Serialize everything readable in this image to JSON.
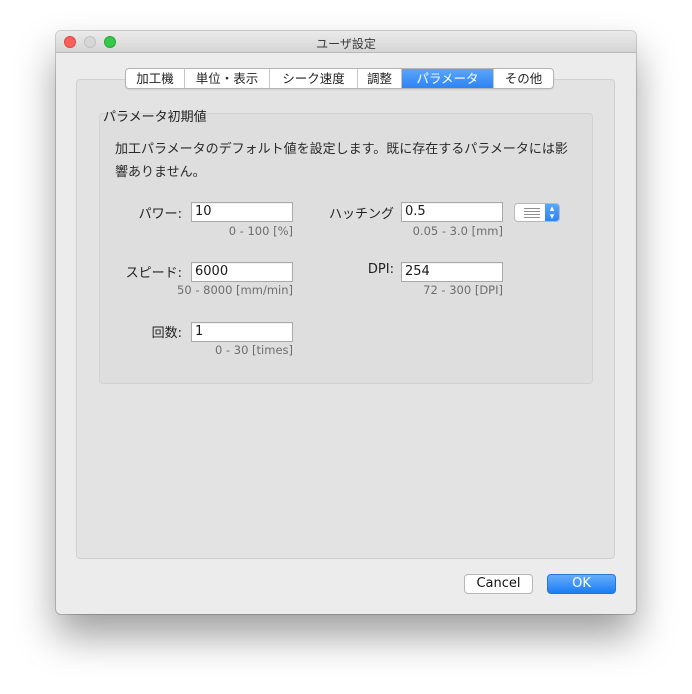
{
  "window": {
    "title": "ユーザ設定"
  },
  "tabs": [
    {
      "label": "加工機",
      "active": false
    },
    {
      "label": "単位・表示",
      "active": false
    },
    {
      "label": "シーク速度",
      "active": false
    },
    {
      "label": "調整",
      "active": false
    },
    {
      "label": "パラメータ",
      "active": true
    },
    {
      "label": "その他",
      "active": false
    }
  ],
  "group": {
    "title": "パラメータ初期値",
    "description": "加工パラメータのデフォルト値を設定します。既に存在するパラメータには影響ありません。"
  },
  "fields": {
    "power": {
      "label": "パワー:",
      "value": "10",
      "range": "0 - 100 [%]"
    },
    "speed": {
      "label": "スピード:",
      "value": "6000",
      "range": "50 - 8000 [mm/min]"
    },
    "count": {
      "label": "回数:",
      "value": "1",
      "range": "0 - 30 [times]"
    },
    "hatching": {
      "label": "ハッチング",
      "value": "0.5",
      "range": "0.05 - 3.0 [mm]",
      "pattern_icon": "hatch-lines-icon"
    },
    "dpi": {
      "label": "DPI:",
      "value": "254",
      "range": "72 - 300 [DPI]"
    }
  },
  "buttons": {
    "cancel": "Cancel",
    "ok": "OK"
  },
  "colors": {
    "accent": "#2d84f4",
    "close": "#fc605b",
    "maximize": "#35c94a"
  }
}
